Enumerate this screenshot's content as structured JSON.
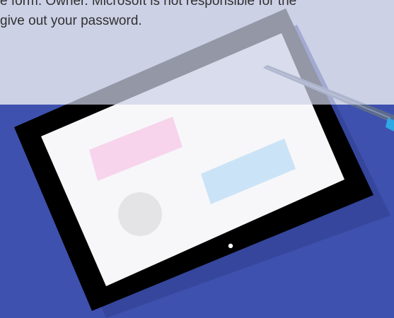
{
  "notice": {
    "line1": "e form. Owner. Microsoft is not responsible for the",
    "line2": "give out your password."
  },
  "colors": {
    "backdrop_top": "#CDD1E6",
    "backdrop_bottom": "#3F51AE",
    "tablet_bezel": "#000000",
    "tablet_screen": "#F7F7F9",
    "pink_block": "#F7D4EC",
    "blue_block": "#CBE3F7",
    "grey_circle": "#E4E4E6",
    "pen_body": "#5B6B8E",
    "pen_tip": "#2FA8E6"
  },
  "icons": [
    "tablet-illustration",
    "pen-icon",
    "home-button-icon"
  ]
}
